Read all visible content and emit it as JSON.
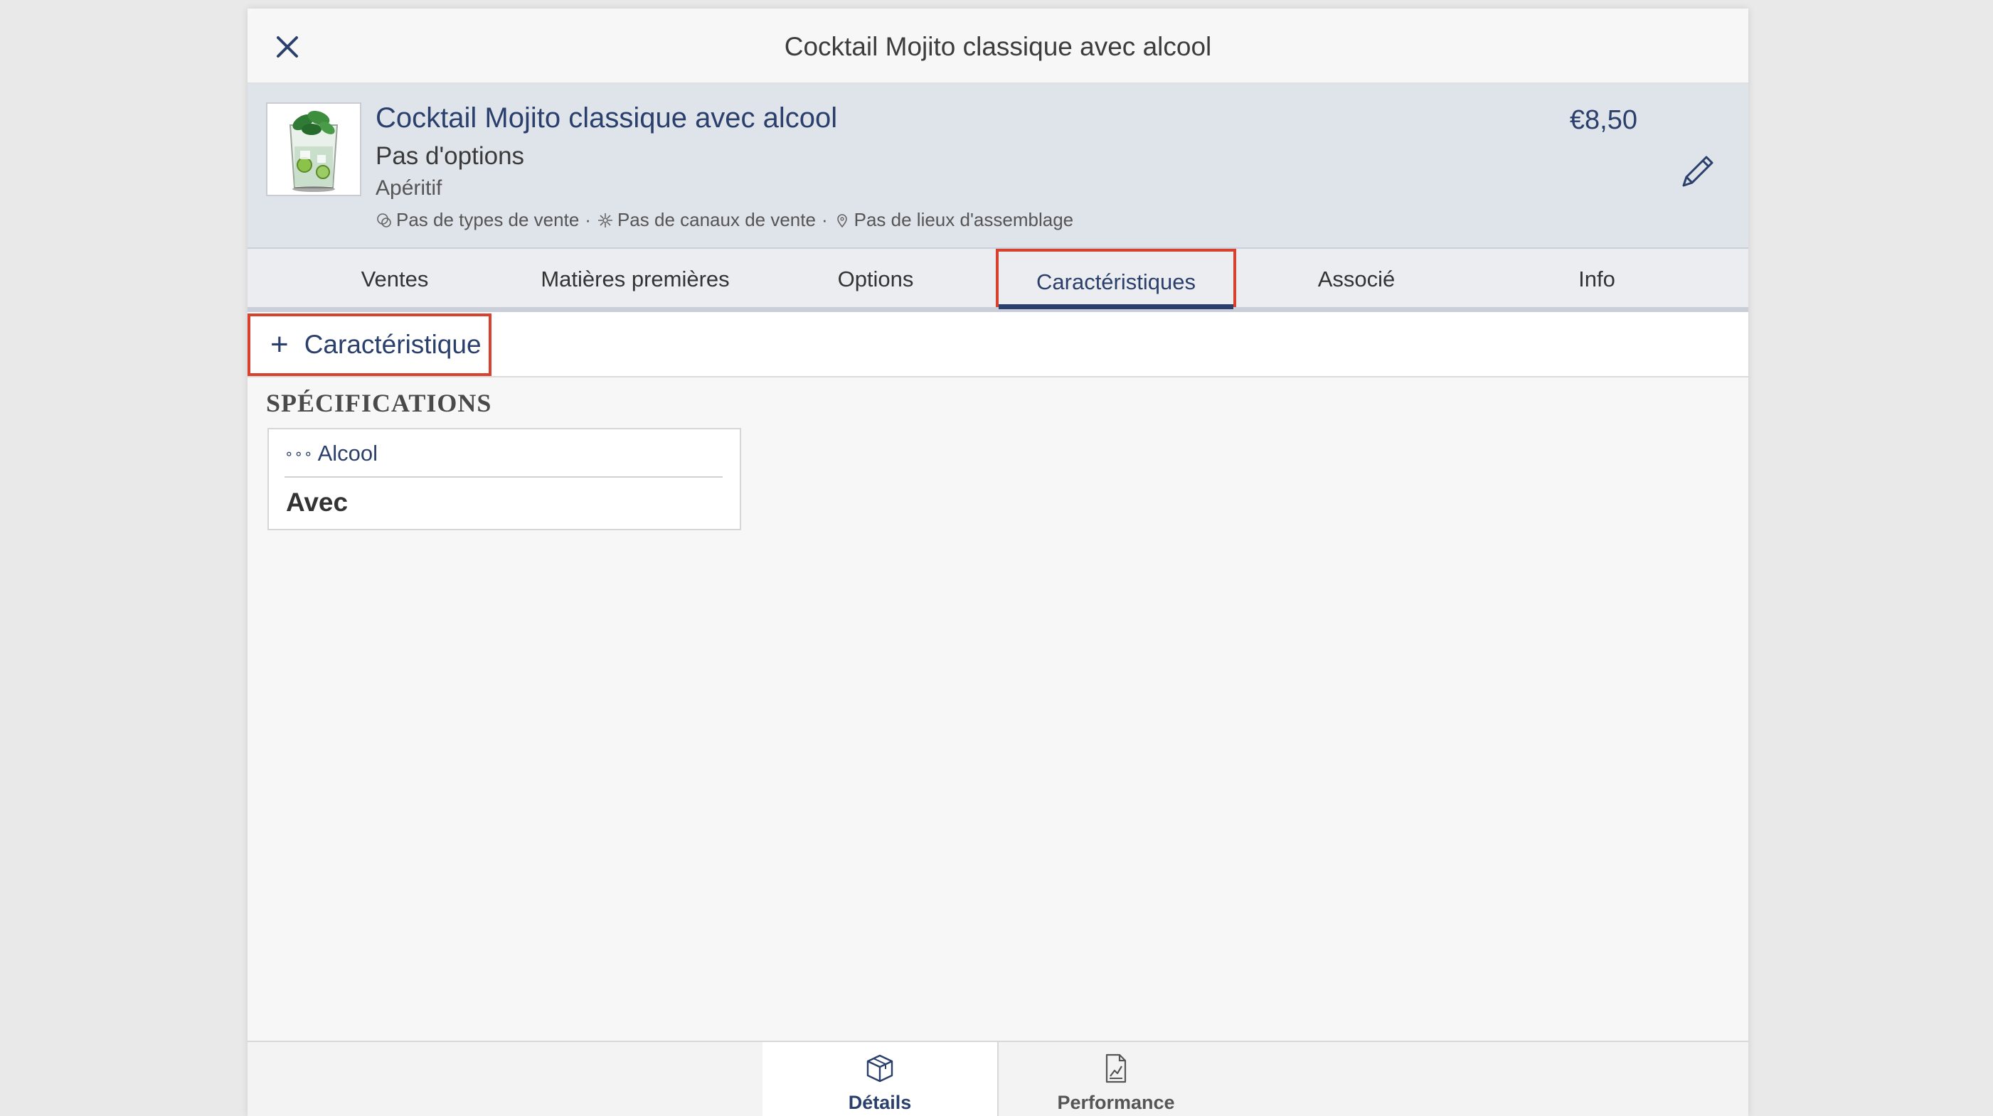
{
  "window": {
    "title": "Cocktail Mojito classique avec alcool"
  },
  "product": {
    "name": "Cocktail Mojito classique avec alcool",
    "options": "Pas d'options",
    "category": "Apéritif",
    "meta": {
      "sale_types": "Pas de types de vente",
      "sale_channels": "Pas de canaux de vente",
      "assembly_places": "Pas de lieux d'assemblage",
      "separator": "·"
    },
    "price": "€8,50"
  },
  "tabs": [
    {
      "label": "Ventes",
      "active": false
    },
    {
      "label": "Matières premières",
      "active": false
    },
    {
      "label": "Options",
      "active": false
    },
    {
      "label": "Caractéristiques",
      "active": true
    },
    {
      "label": "Associé",
      "active": false
    },
    {
      "label": "Info",
      "active": false
    }
  ],
  "toolbar": {
    "add_icon": "+",
    "add_label": "Caractéristique"
  },
  "specs": {
    "section_title": "SPÉCIFICATIONS",
    "items": [
      {
        "dots": "∘∘∘",
        "label": "Alcool",
        "value": "Avec"
      }
    ]
  },
  "bottom_nav": {
    "items": [
      {
        "label": "Détails",
        "icon": "box-icon",
        "active": true
      },
      {
        "label": "Performance",
        "icon": "chart-document-icon",
        "active": false
      }
    ]
  },
  "colors": {
    "accent": "#2a3f6b",
    "highlight": "#d9412f",
    "header_bg": "#dfe3ea"
  }
}
